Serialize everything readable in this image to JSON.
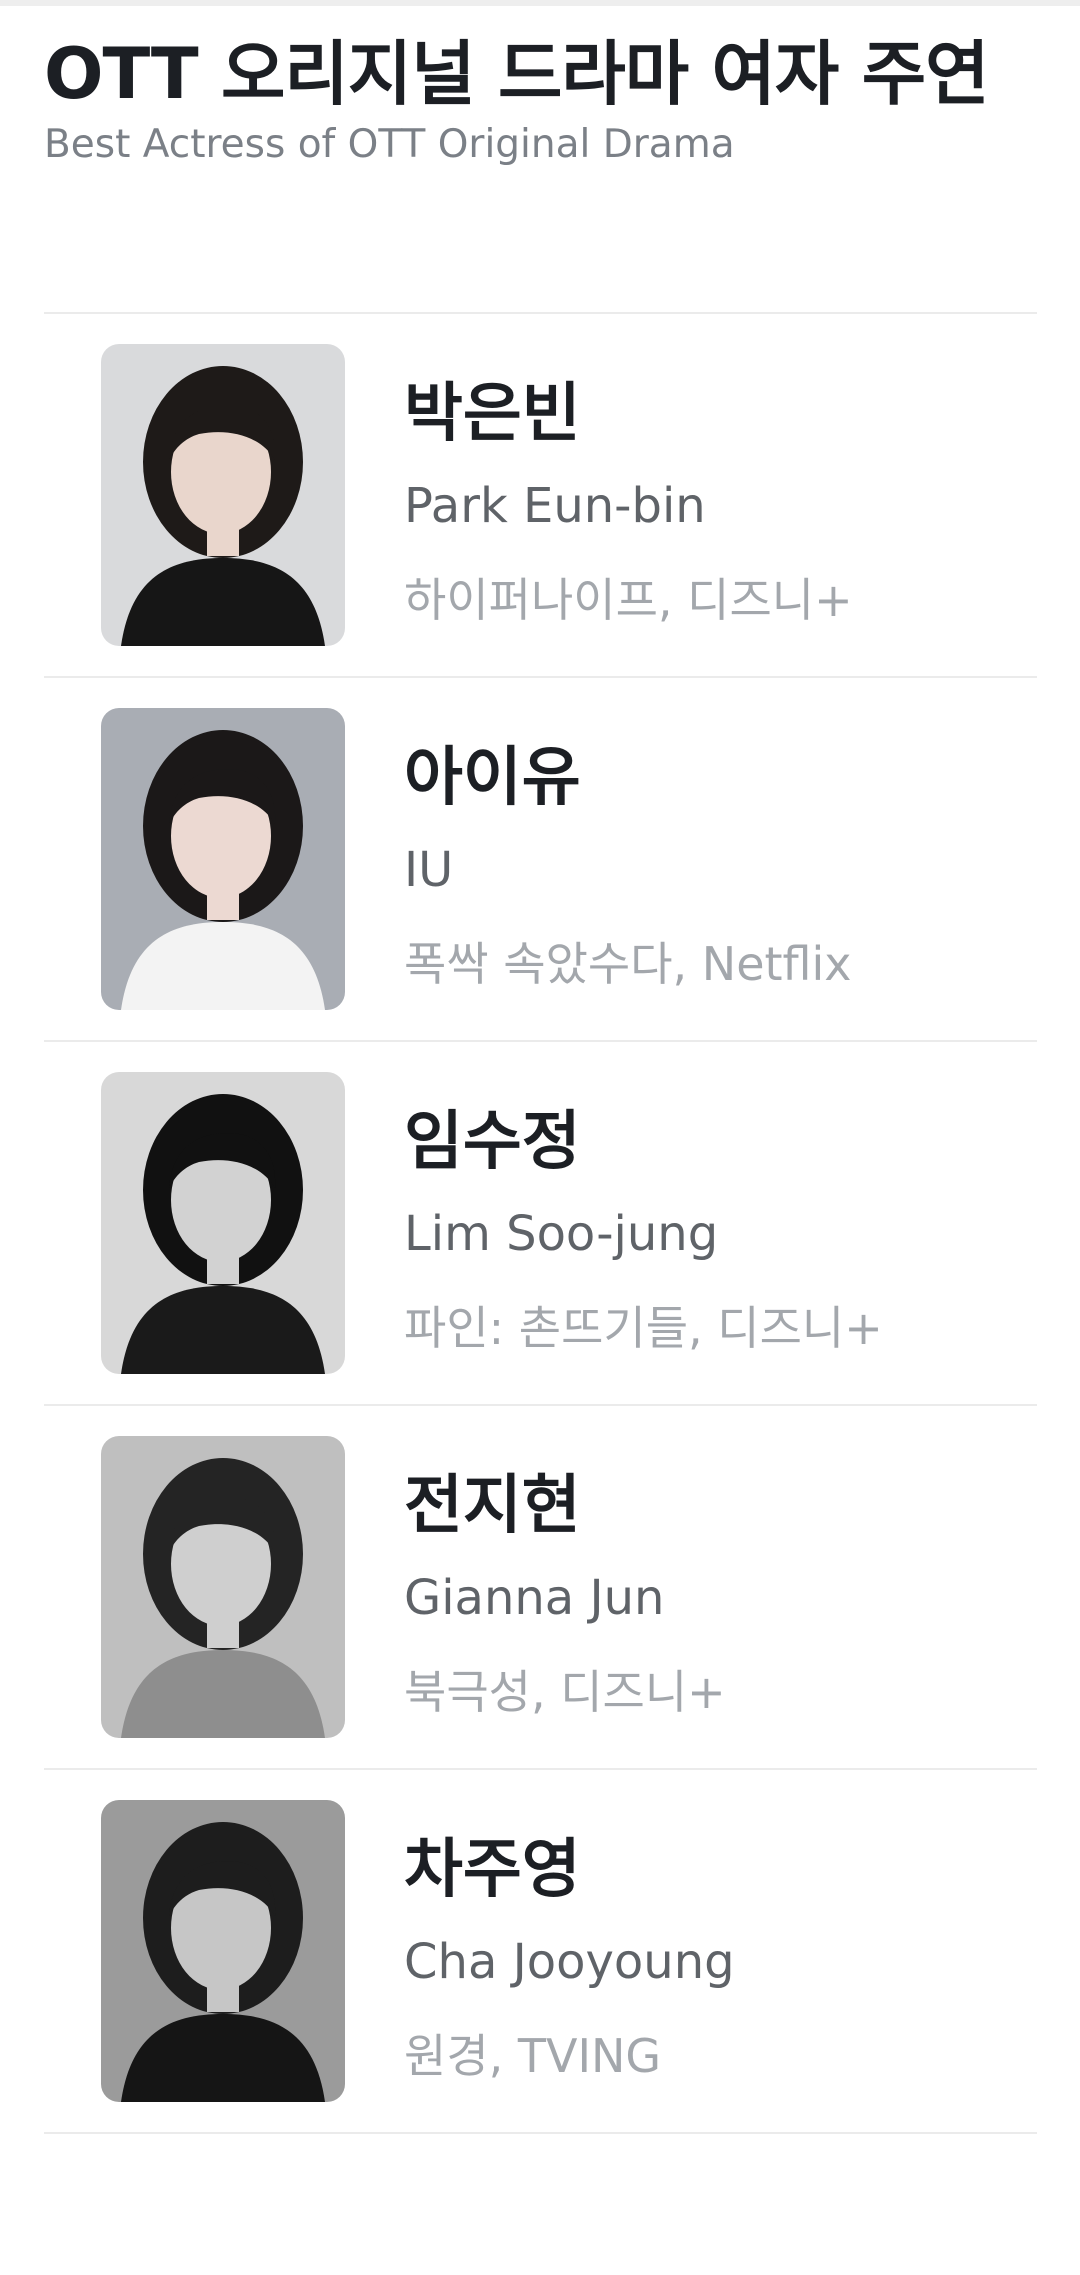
{
  "header": {
    "title": "OTT 오리지널 드라마 여자 주연",
    "subtitle": "Best Actress of OTT Original Drama"
  },
  "actresses": [
    {
      "name_ko": "박은빈",
      "name_en": "Park Eun-bin",
      "work": "하이퍼나이프, 디즈니+",
      "photo": {
        "bg": "#d9dadc",
        "hair": "#1e1a18",
        "skin": "#e9d6cc",
        "clothes": "#161616"
      }
    },
    {
      "name_ko": "아이유",
      "name_en": "IU",
      "work": "폭싹 속았수다, Netflix",
      "photo": {
        "bg": "#a9adb4",
        "hair": "#1b1818",
        "skin": "#ecd9d2",
        "clothes": "#f3f3f3"
      }
    },
    {
      "name_ko": "임수정",
      "name_en": "Lim Soo-jung",
      "work": "파인: 촌뜨기들, 디즈니+",
      "photo": {
        "bg": "#d8d8d8",
        "hair": "#111111",
        "skin": "#d2d2d2",
        "clothes": "#1a1a1a"
      }
    },
    {
      "name_ko": "전지현",
      "name_en": "Gianna Jun",
      "work": "북극성, 디즈니+",
      "photo": {
        "bg": "#bfbfbf",
        "hair": "#242424",
        "skin": "#cfcfcf",
        "clothes": "#8e8e8e"
      }
    },
    {
      "name_ko": "차주영",
      "name_en": "Cha Jooyoung",
      "work": "원경, TVING",
      "photo": {
        "bg": "#9b9b9b",
        "hair": "#1d1d1d",
        "skin": "#c6c6c6",
        "clothes": "#151515"
      }
    }
  ]
}
